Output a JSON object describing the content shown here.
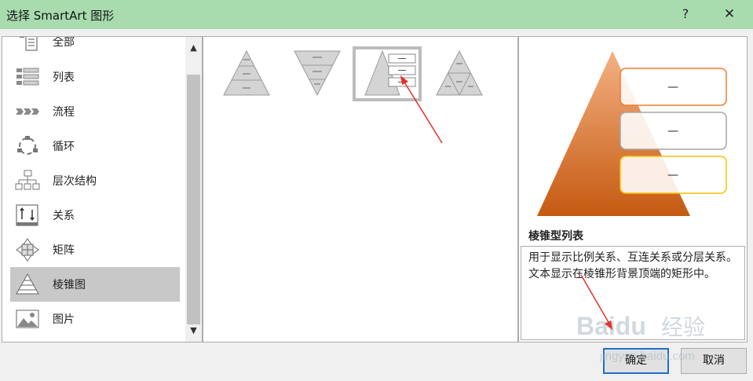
{
  "window": {
    "title": "选择 SmartArt 图形",
    "help": "?",
    "close": "✕"
  },
  "categories": [
    {
      "label": "全部",
      "icon": "all-icon"
    },
    {
      "label": "列表",
      "icon": "list-icon"
    },
    {
      "label": "流程",
      "icon": "process-icon"
    },
    {
      "label": "循环",
      "icon": "cycle-icon"
    },
    {
      "label": "层次结构",
      "icon": "hierarchy-icon"
    },
    {
      "label": "关系",
      "icon": "relationship-icon"
    },
    {
      "label": "矩阵",
      "icon": "matrix-icon"
    },
    {
      "label": "棱锥图",
      "icon": "pyramid-icon",
      "selected": true
    },
    {
      "label": "图片",
      "icon": "picture-icon"
    }
  ],
  "scroll": {
    "up": "▲",
    "down": "▼"
  },
  "layouts": [
    {
      "name": "basic-pyramid"
    },
    {
      "name": "inverted-pyramid"
    },
    {
      "name": "pyramid-list",
      "selected": true
    },
    {
      "name": "segmented-pyramid"
    }
  ],
  "preview": {
    "title": "棱锥型列表",
    "description": "用于显示比例关系、互连关系或分层关系。文本显示在棱锥形背景顶端的矩形中。",
    "box_text": "—",
    "colors": {
      "pyramid_top": "#f4b183",
      "pyramid_bottom": "#c55a11",
      "box1": "#ed7d31",
      "box2": "#a5a5a5",
      "box3": "#ffc000"
    }
  },
  "buttons": {
    "ok": "确定",
    "cancel": "取消"
  },
  "watermark": {
    "brand": "Baidu",
    "brand_suffix": "经验",
    "url": "jingyan.baidu.com"
  },
  "colors": {
    "titlebar": "#a8dcaf",
    "selected": "#c8c8c8",
    "annotation": "#e8302c",
    "default_button_border": "#1f6fc9"
  }
}
